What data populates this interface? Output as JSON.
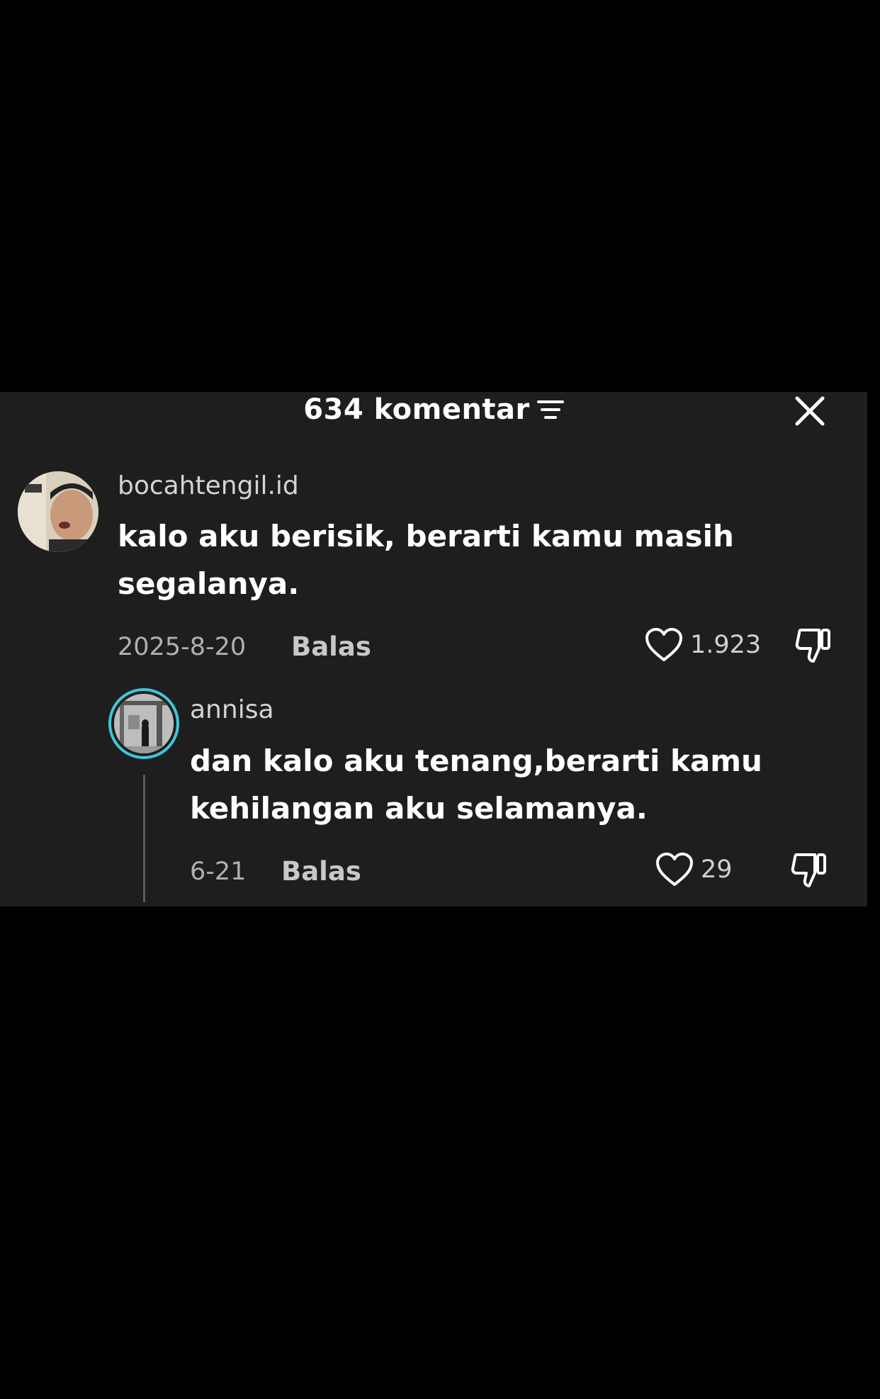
{
  "header": {
    "comment_count": "634 komentar"
  },
  "comments": [
    {
      "username": "bocahtengil.id",
      "text": "kalo aku berisik, berarti kamu masih segalanya.",
      "date": "2025-8-20",
      "reply_label": "Balas",
      "likes": "1.923"
    },
    {
      "username": "annisa",
      "text": "dan kalo aku tenang,berarti kamu kehilangan aku selamanya.",
      "date": "6-21",
      "reply_label": "Balas",
      "likes": "29"
    }
  ],
  "colors": {
    "panel_bg": "#1e1e1f",
    "avatar_ring": "#3fc7d8"
  }
}
